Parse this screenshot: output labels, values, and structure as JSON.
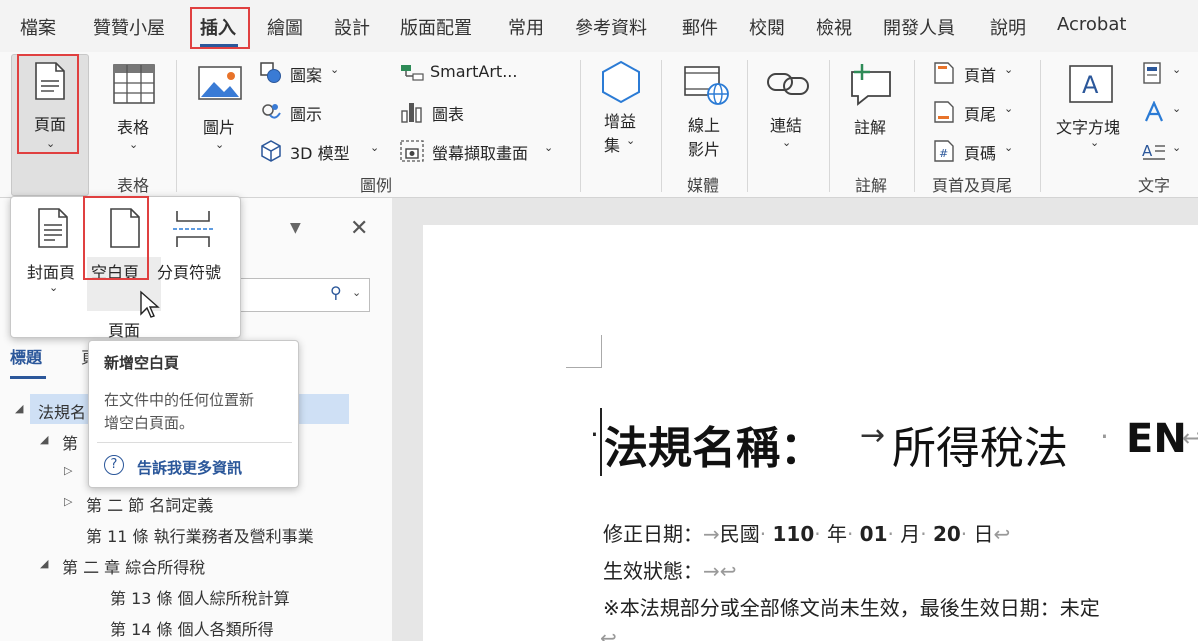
{
  "menu": {
    "tabs": [
      "檔案",
      "贊贊小屋",
      "插入",
      "繪圖",
      "設計",
      "版面配置",
      "常用",
      "參考資料",
      "郵件",
      "校閱",
      "檢視",
      "開發人員",
      "說明",
      "Acrobat"
    ]
  },
  "ribbon": {
    "page_button": "頁面",
    "table_button": "表格",
    "table_group": "表格",
    "picture_button": "圖片",
    "shapes": "圖案",
    "icons": "圖示",
    "model3d": "3D 模型",
    "smartart": "SmartArt...",
    "chart": "圖表",
    "screenshot": "螢幕擷取畫面",
    "illustrations_group": "圖例",
    "addins_line1": "增益",
    "addins_line2": "集",
    "online_video_line1": "線上",
    "online_video_line2": "影片",
    "media_group": "媒體",
    "link": "連結",
    "comment": "註解",
    "comments_group": "註解",
    "header": "頁首",
    "footer": "頁尾",
    "page_number": "頁碼",
    "header_footer_group": "頁首及頁尾",
    "textbox": "文字方塊",
    "text_group": "文字",
    "icon_names": [
      "page-icon",
      "table-icon",
      "picture-icon",
      "shapes-icon",
      "icons-icon",
      "3d-model-icon",
      "smartart-icon",
      "chart-icon",
      "screenshot-icon",
      "addins-icon",
      "online-video-icon",
      "link-icon",
      "comment-icon",
      "header-icon",
      "footer-icon",
      "page-number-icon",
      "textbox-icon"
    ]
  },
  "dropdown": {
    "cover_page": "封面頁",
    "blank_page": "空白頁",
    "page_break": "分頁符號",
    "group_label": "頁面"
  },
  "tooltip": {
    "title": "新增空白頁",
    "body_line1": "在文件中的任何位置新",
    "body_line2": "增空白頁面。",
    "link": "告訴我更多資訊"
  },
  "navpane": {
    "tab_headings": "標題",
    "tab_pages_partial": "頁",
    "items": [
      "法規名",
      "第",
      "第 二 節 名詞定義",
      "第 11 條 執行業務者及營利事業",
      "第 二 章 綜合所得稅",
      "第 13 條 個人綜所稅計算",
      "第 14 條 個人各類所得"
    ]
  },
  "document": {
    "title_label": "法規名稱：",
    "title_value": "所得稅法",
    "title_suffix": "EN",
    "line1_label": "修正日期：",
    "line1_value_a": "民國",
    "line1_year": "110",
    "line1_year_unit": "年",
    "line1_month": "01",
    "line1_month_unit": "月",
    "line1_day": "20",
    "line1_day_unit": "日",
    "line2_label": "生效狀態：",
    "line3": "※本法規部分或全部條文尚未生效，最後生效日期：未定"
  },
  "colors": {
    "accent": "#2b579a",
    "highlight_box": "#e04040",
    "nav_selection": "#cfe0f5",
    "link_blue": "#2b579a"
  }
}
